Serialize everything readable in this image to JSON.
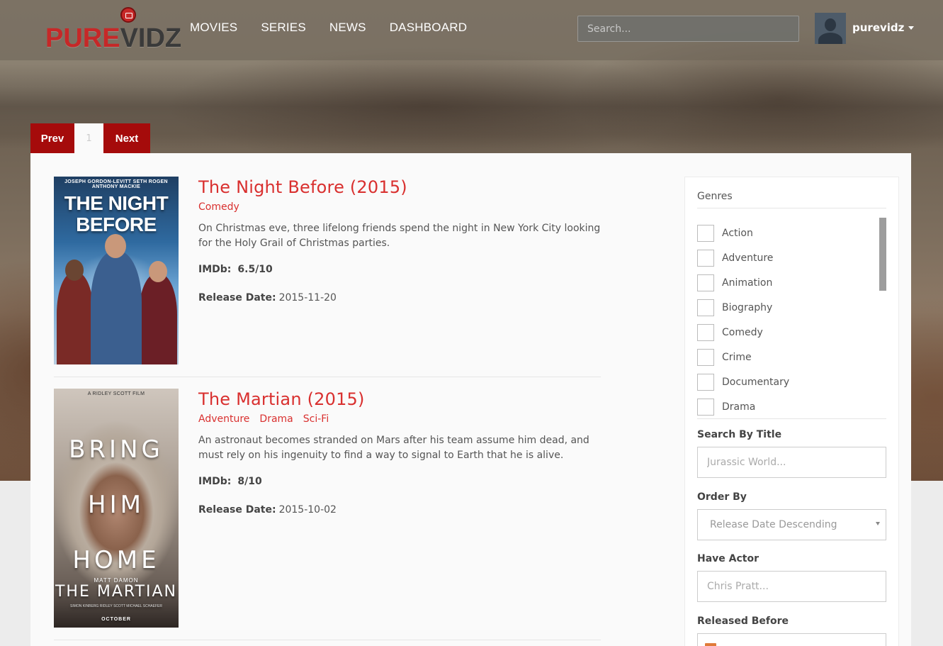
{
  "header": {
    "logo": {
      "part1": "PURE",
      "part2": "VIDZ"
    },
    "nav": [
      "MOVIES",
      "SERIES",
      "NEWS",
      "DASHBOARD"
    ],
    "search_placeholder": "Search...",
    "username": "purevidz"
  },
  "pagination": {
    "prev": "Prev",
    "current": "1",
    "next": "Next"
  },
  "movies": [
    {
      "title": "The Night Before (2015)",
      "genres": [
        "Comedy"
      ],
      "description": "On Christmas eve, three lifelong friends spend the night in New York City looking for the Holy Grail of Christmas parties.",
      "imdb_label": "IMDb:",
      "imdb": "6.5/10",
      "release_label": "Release Date:",
      "release_date": "2015-11-20",
      "poster": {
        "credits": "JOSEPH GORDON-LEVITT   SETH ROGEN   ANTHONY MACKIE",
        "line1": "THE NIGHT",
        "line2": "BEFORE"
      }
    },
    {
      "title": "The Martian (2015)",
      "genres": [
        "Adventure",
        "Drama",
        "Sci-Fi"
      ],
      "description": "An astronaut becomes stranded on Mars after his team assume him dead, and must rely on his ingenuity to find a way to signal to Earth that he is alive.",
      "imdb_label": "IMDb:",
      "imdb": "8/10",
      "release_label": "Release Date:",
      "release_date": "2015-10-02",
      "poster": {
        "credits": "A RIDLEY SCOTT FILM",
        "line1": "BRING",
        "line2": "HIM",
        "line3": "HOME",
        "small": "MATT DAMON",
        "title": "THE MARTIAN",
        "tiny": "SIMON KINBERG RIDLEY SCOTT MICHAEL SCHAEFER",
        "month": "OCTOBER"
      }
    }
  ],
  "sidebar": {
    "genres_heading": "Genres",
    "genres": [
      "Action",
      "Adventure",
      "Animation",
      "Biography",
      "Comedy",
      "Crime",
      "Documentary",
      "Drama"
    ],
    "search_title_label": "Search By Title",
    "search_title_placeholder": "Jurassic World...",
    "order_by_label": "Order By",
    "order_by_value": "Release Date Descending",
    "actor_label": "Have Actor",
    "actor_placeholder": "Chris Pratt...",
    "released_before_label": "Released Before"
  }
}
